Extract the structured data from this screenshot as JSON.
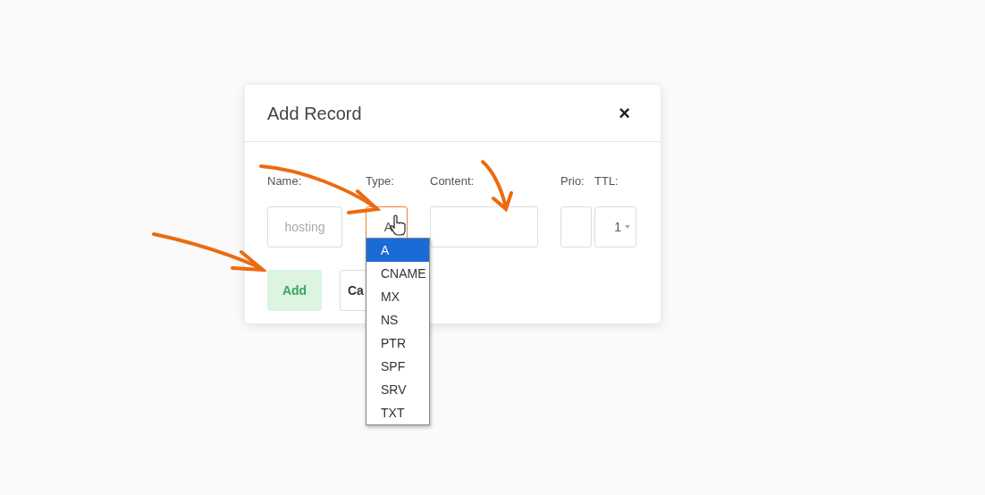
{
  "dialog": {
    "title": "Add Record",
    "close": "×"
  },
  "fields": [
    {
      "kind": "text",
      "label": "Name:",
      "placeholder": "hosting"
    },
    {
      "kind": "select",
      "label": "Type:",
      "value": "A",
      "focused": true
    },
    {
      "kind": "text",
      "label": "Content:"
    },
    {
      "kind": "text",
      "label": "Prio:"
    },
    {
      "kind": "select",
      "label": "TTL:",
      "value": "1",
      "focused": false
    }
  ],
  "buttons": [
    {
      "kind": "primary",
      "label": "Add"
    },
    {
      "kind": "secondary",
      "label": "Ca"
    }
  ],
  "type_options": [
    {
      "label": "A",
      "selected": true
    },
    {
      "label": "CNAME",
      "selected": false
    },
    {
      "label": "MX",
      "selected": false
    },
    {
      "label": "NS",
      "selected": false
    },
    {
      "label": "PTR",
      "selected": false
    },
    {
      "label": "SPF",
      "selected": false
    },
    {
      "label": "SRV",
      "selected": false
    },
    {
      "label": "TXT",
      "selected": false
    }
  ]
}
